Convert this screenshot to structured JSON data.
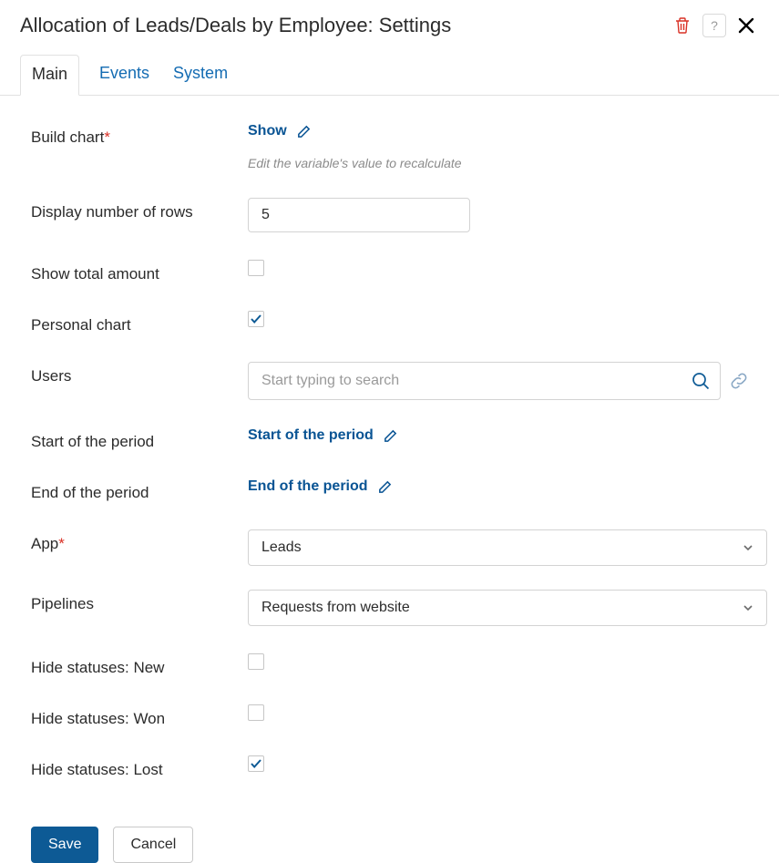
{
  "header": {
    "title": "Allocation of Leads/Deals by Employee: Settings"
  },
  "tabs": {
    "items": [
      {
        "label": "Main",
        "active": true
      },
      {
        "label": "Events",
        "active": false
      },
      {
        "label": "System",
        "active": false
      }
    ]
  },
  "form": {
    "build_chart": {
      "label": "Build chart",
      "required": true,
      "value": "Show",
      "hint": "Edit the variable's value to recalculate"
    },
    "display_rows": {
      "label": "Display number of rows",
      "value": "5"
    },
    "show_total": {
      "label": "Show total amount",
      "checked": false
    },
    "personal_chart": {
      "label": "Personal chart",
      "checked": true
    },
    "users": {
      "label": "Users",
      "placeholder": "Start typing to search"
    },
    "start_period": {
      "label": "Start of the period",
      "value": "Start of the period"
    },
    "end_period": {
      "label": "End of the period",
      "value": "End of the period"
    },
    "app": {
      "label": "App",
      "required": true,
      "value": "Leads"
    },
    "pipelines": {
      "label": "Pipelines",
      "value": "Requests from website"
    },
    "hide_new": {
      "label": "Hide statuses: New",
      "checked": false
    },
    "hide_won": {
      "label": "Hide statuses: Won",
      "checked": false
    },
    "hide_lost": {
      "label": "Hide statuses: Lost",
      "checked": true
    }
  },
  "footer": {
    "save": "Save",
    "cancel": "Cancel"
  }
}
